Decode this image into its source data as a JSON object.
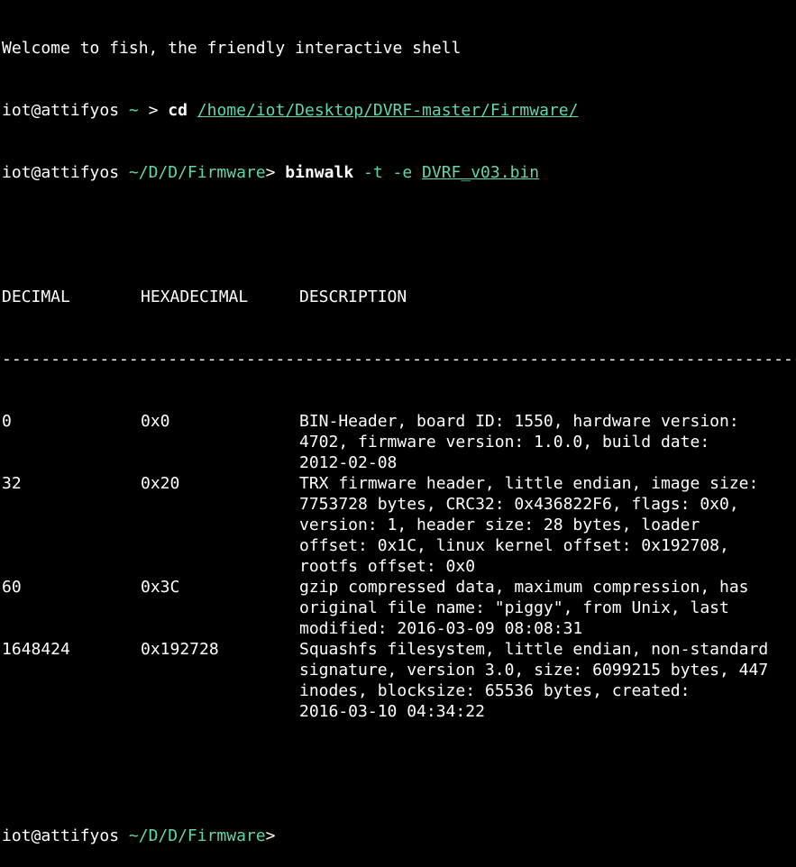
{
  "terminal": {
    "welcome": "Welcome to fish, the friendly interactive shell",
    "prompt1": {
      "user": "iot@attifyos",
      "path": "~",
      "gt": ">",
      "cmd": "cd",
      "arg": "/home/iot/Desktop/DVRF-master/Firmware/"
    },
    "prompt2": {
      "user": "iot@attifyos",
      "path": "~/D/D/Firmware",
      "gt": ">",
      "cmd": "binwalk",
      "opts": "-t -e",
      "arg": "DVRF_v03.bin"
    },
    "headers": [
      "DECIMAL",
      "HEXADECIMAL",
      "DESCRIPTION"
    ],
    "separator": "-------------------------------------------------------------------------------------------",
    "rows": [
      {
        "dec": "0",
        "hex": "0x0",
        "desc": [
          "BIN-Header, board ID: 1550, hardware version:",
          "4702, firmware version: 1.0.0, build date:",
          "2012-02-08"
        ]
      },
      {
        "dec": "32",
        "hex": "0x20",
        "desc": [
          "TRX firmware header, little endian, image size:",
          "7753728 bytes, CRC32: 0x436822F6, flags: 0x0,",
          "version: 1, header size: 28 bytes, loader",
          "offset: 0x1C, linux kernel offset: 0x192708,",
          "rootfs offset: 0x0"
        ]
      },
      {
        "dec": "60",
        "hex": "0x3C",
        "desc": [
          "gzip compressed data, maximum compression, has",
          "original file name: \"piggy\", from Unix, last",
          "modified: 2016-03-09 08:08:31"
        ]
      },
      {
        "dec": "1648424",
        "hex": "0x192728",
        "desc": [
          "Squashfs filesystem, little endian, non-standard",
          "signature, version 3.0, size: 6099215 bytes, 447",
          "inodes, blocksize: 65536 bytes, created:",
          "2016-03-10 04:34:22"
        ]
      }
    ],
    "prompt3": {
      "user": "iot@attifyos",
      "path": "~/D/D/Firmware",
      "gt": ">"
    }
  }
}
